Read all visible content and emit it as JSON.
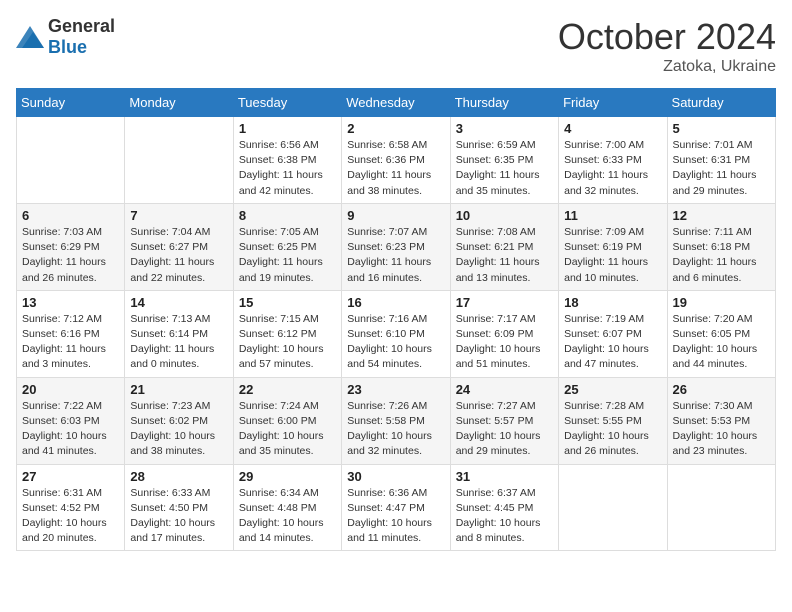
{
  "header": {
    "logo_general": "General",
    "logo_blue": "Blue",
    "month_title": "October 2024",
    "location": "Zatoka, Ukraine"
  },
  "days_of_week": [
    "Sunday",
    "Monday",
    "Tuesday",
    "Wednesday",
    "Thursday",
    "Friday",
    "Saturday"
  ],
  "weeks": [
    [
      {
        "day": "",
        "info": ""
      },
      {
        "day": "",
        "info": ""
      },
      {
        "day": "1",
        "info": "Sunrise: 6:56 AM\nSunset: 6:38 PM\nDaylight: 11 hours and 42 minutes."
      },
      {
        "day": "2",
        "info": "Sunrise: 6:58 AM\nSunset: 6:36 PM\nDaylight: 11 hours and 38 minutes."
      },
      {
        "day": "3",
        "info": "Sunrise: 6:59 AM\nSunset: 6:35 PM\nDaylight: 11 hours and 35 minutes."
      },
      {
        "day": "4",
        "info": "Sunrise: 7:00 AM\nSunset: 6:33 PM\nDaylight: 11 hours and 32 minutes."
      },
      {
        "day": "5",
        "info": "Sunrise: 7:01 AM\nSunset: 6:31 PM\nDaylight: 11 hours and 29 minutes."
      }
    ],
    [
      {
        "day": "6",
        "info": "Sunrise: 7:03 AM\nSunset: 6:29 PM\nDaylight: 11 hours and 26 minutes."
      },
      {
        "day": "7",
        "info": "Sunrise: 7:04 AM\nSunset: 6:27 PM\nDaylight: 11 hours and 22 minutes."
      },
      {
        "day": "8",
        "info": "Sunrise: 7:05 AM\nSunset: 6:25 PM\nDaylight: 11 hours and 19 minutes."
      },
      {
        "day": "9",
        "info": "Sunrise: 7:07 AM\nSunset: 6:23 PM\nDaylight: 11 hours and 16 minutes."
      },
      {
        "day": "10",
        "info": "Sunrise: 7:08 AM\nSunset: 6:21 PM\nDaylight: 11 hours and 13 minutes."
      },
      {
        "day": "11",
        "info": "Sunrise: 7:09 AM\nSunset: 6:19 PM\nDaylight: 11 hours and 10 minutes."
      },
      {
        "day": "12",
        "info": "Sunrise: 7:11 AM\nSunset: 6:18 PM\nDaylight: 11 hours and 6 minutes."
      }
    ],
    [
      {
        "day": "13",
        "info": "Sunrise: 7:12 AM\nSunset: 6:16 PM\nDaylight: 11 hours and 3 minutes."
      },
      {
        "day": "14",
        "info": "Sunrise: 7:13 AM\nSunset: 6:14 PM\nDaylight: 11 hours and 0 minutes."
      },
      {
        "day": "15",
        "info": "Sunrise: 7:15 AM\nSunset: 6:12 PM\nDaylight: 10 hours and 57 minutes."
      },
      {
        "day": "16",
        "info": "Sunrise: 7:16 AM\nSunset: 6:10 PM\nDaylight: 10 hours and 54 minutes."
      },
      {
        "day": "17",
        "info": "Sunrise: 7:17 AM\nSunset: 6:09 PM\nDaylight: 10 hours and 51 minutes."
      },
      {
        "day": "18",
        "info": "Sunrise: 7:19 AM\nSunset: 6:07 PM\nDaylight: 10 hours and 47 minutes."
      },
      {
        "day": "19",
        "info": "Sunrise: 7:20 AM\nSunset: 6:05 PM\nDaylight: 10 hours and 44 minutes."
      }
    ],
    [
      {
        "day": "20",
        "info": "Sunrise: 7:22 AM\nSunset: 6:03 PM\nDaylight: 10 hours and 41 minutes."
      },
      {
        "day": "21",
        "info": "Sunrise: 7:23 AM\nSunset: 6:02 PM\nDaylight: 10 hours and 38 minutes."
      },
      {
        "day": "22",
        "info": "Sunrise: 7:24 AM\nSunset: 6:00 PM\nDaylight: 10 hours and 35 minutes."
      },
      {
        "day": "23",
        "info": "Sunrise: 7:26 AM\nSunset: 5:58 PM\nDaylight: 10 hours and 32 minutes."
      },
      {
        "day": "24",
        "info": "Sunrise: 7:27 AM\nSunset: 5:57 PM\nDaylight: 10 hours and 29 minutes."
      },
      {
        "day": "25",
        "info": "Sunrise: 7:28 AM\nSunset: 5:55 PM\nDaylight: 10 hours and 26 minutes."
      },
      {
        "day": "26",
        "info": "Sunrise: 7:30 AM\nSunset: 5:53 PM\nDaylight: 10 hours and 23 minutes."
      }
    ],
    [
      {
        "day": "27",
        "info": "Sunrise: 6:31 AM\nSunset: 4:52 PM\nDaylight: 10 hours and 20 minutes."
      },
      {
        "day": "28",
        "info": "Sunrise: 6:33 AM\nSunset: 4:50 PM\nDaylight: 10 hours and 17 minutes."
      },
      {
        "day": "29",
        "info": "Sunrise: 6:34 AM\nSunset: 4:48 PM\nDaylight: 10 hours and 14 minutes."
      },
      {
        "day": "30",
        "info": "Sunrise: 6:36 AM\nSunset: 4:47 PM\nDaylight: 10 hours and 11 minutes."
      },
      {
        "day": "31",
        "info": "Sunrise: 6:37 AM\nSunset: 4:45 PM\nDaylight: 10 hours and 8 minutes."
      },
      {
        "day": "",
        "info": ""
      },
      {
        "day": "",
        "info": ""
      }
    ]
  ]
}
